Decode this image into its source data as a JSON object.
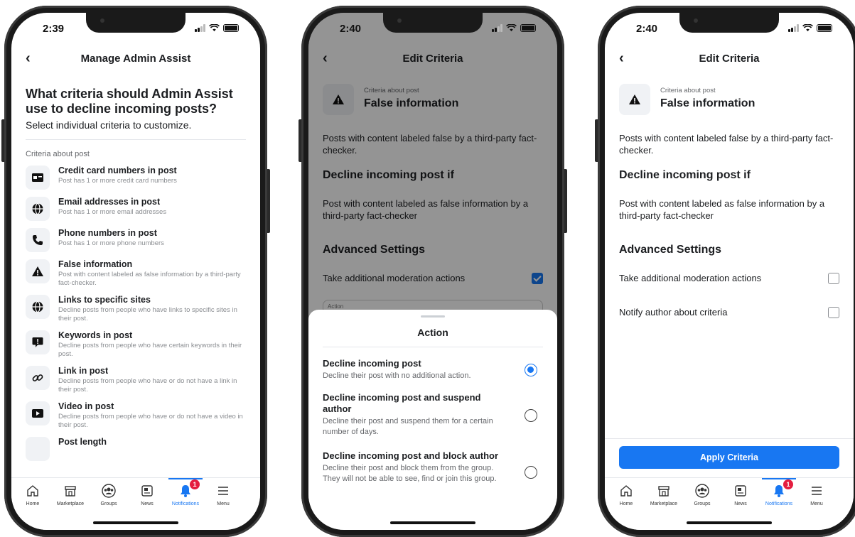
{
  "tabs": [
    {
      "label": "Home",
      "icon": "home-icon"
    },
    {
      "label": "Marketplace",
      "icon": "marketplace-icon"
    },
    {
      "label": "Groups",
      "icon": "groups-icon"
    },
    {
      "label": "News",
      "icon": "news-icon"
    },
    {
      "label": "Notifications",
      "icon": "bell-icon",
      "badge": "1"
    },
    {
      "label": "Menu",
      "icon": "menu-icon"
    }
  ],
  "phone1": {
    "time": "2:39",
    "nav_title": "Manage Admin Assist",
    "heading": "What criteria should Admin Assist use to decline incoming posts?",
    "subheading": "Select individual criteria to customize.",
    "section_label": "Criteria about post",
    "criteria": [
      {
        "title": "Credit card numbers in post",
        "desc": "Post has 1 or more credit card numbers",
        "icon": "credit-card-icon"
      },
      {
        "title": "Email addresses in post",
        "desc": "Post has 1 or more email addresses",
        "icon": "globe-icon"
      },
      {
        "title": "Phone numbers in post",
        "desc": "Post has 1 or more phone numbers",
        "icon": "phone-icon"
      },
      {
        "title": "False information",
        "desc": "Post with content labeled as false information by a third-party fact-checker.",
        "icon": "warning-icon"
      },
      {
        "title": "Links to specific sites",
        "desc": "Decline posts from people who have links to specific sites in their post.",
        "icon": "globe-icon"
      },
      {
        "title": "Keywords in post",
        "desc": "Decline posts from people who have certain keywords in their post.",
        "icon": "speech-bubble-icon"
      },
      {
        "title": "Link in post",
        "desc": "Decline posts from people who have or do not have a link in their post.",
        "icon": "link-icon"
      },
      {
        "title": "Video in post",
        "desc": "Decline posts from people who have or do not have a video in their post.",
        "icon": "video-icon"
      },
      {
        "title": "Post length",
        "desc": "",
        "icon": "text-icon"
      }
    ]
  },
  "phone2": {
    "time": "2:40",
    "nav_title": "Edit Criteria",
    "category": "Criteria about post",
    "criterion": "False information",
    "description": "Posts with content labeled false by a third-party fact-checker.",
    "decline_heading": "Decline incoming post if",
    "decline_text": "Post with content labeled as false information by a third-party fact-checker",
    "advanced_heading": "Advanced Settings",
    "moderation_label": "Take additional moderation actions",
    "moderation_checked": true,
    "action_peek": "Action",
    "sheet_title": "Action",
    "options": [
      {
        "title": "Decline incoming post",
        "desc": "Decline their post with no additional action.",
        "selected": true
      },
      {
        "title": "Decline incoming post and suspend author",
        "desc": "Decline their post and suspend them for a certain number of days.",
        "selected": false
      },
      {
        "title": "Decline incoming post and block author",
        "desc": "Decline their post and block them from the group. They will not be able to see, find or join this group.",
        "selected": false
      }
    ]
  },
  "phone3": {
    "time": "2:40",
    "nav_title": "Edit Criteria",
    "category": "Criteria about post",
    "criterion": "False information",
    "description": "Posts with content labeled false by a third-party fact-checker.",
    "decline_heading": "Decline incoming post if",
    "decline_text": "Post with content labeled as false information by a third-party fact-checker",
    "advanced_heading": "Advanced Settings",
    "moderation_label": "Take additional moderation actions",
    "moderation_checked": false,
    "notify_label": "Notify author about criteria",
    "notify_checked": false,
    "apply_label": "Apply Criteria"
  },
  "colors": {
    "accent": "#1877f2",
    "badge": "#e41e3f"
  }
}
